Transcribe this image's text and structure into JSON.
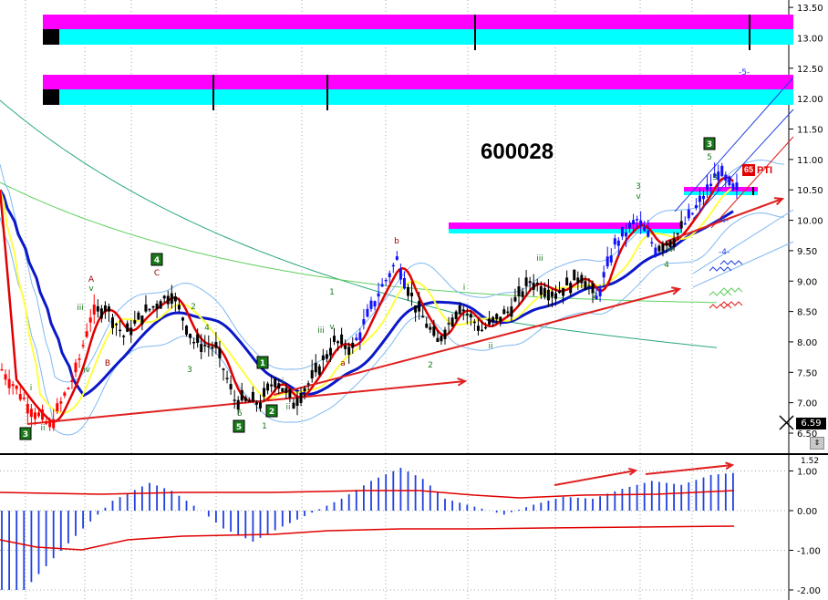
{
  "symbol": "600028",
  "pti": {
    "value": "65",
    "label": "PTI"
  },
  "last_price": "6.59",
  "osc_top_label": "1.52",
  "colors": {
    "bar": "#000000",
    "bar_up": "#1010ff",
    "bar_down": "#ff0000",
    "ma_fast": "#e00000",
    "ma_mid": "#ffff40",
    "ma_slow": "#0a18c8",
    "ma_long": "#2aa878",
    "ma_green": "#60d060",
    "ma_env": "#80b8f0",
    "magenta": "#ff00ff",
    "cyan": "#00ffff",
    "trend": "#e02020",
    "histogram": "#2040e0",
    "osc_line": "#e00000",
    "label_green": "#1a7a1a",
    "label_red": "#a00000"
  },
  "chart_data": [
    {
      "type": "candlestick",
      "title": "600028",
      "y_axis": {
        "ticks": [
          "13.50",
          "13.00",
          "12.50",
          "12.00",
          "11.50",
          "11.00",
          "10.50",
          "10.00",
          "9.50",
          "9.00",
          "8.50",
          "8.00",
          "7.50",
          "7.00",
          "6.50"
        ],
        "ylim": [
          6.3,
          13.6
        ]
      },
      "close_path": [
        {
          "bar": 0,
          "close": 7.55
        },
        {
          "bar": 8,
          "close": 6.9
        },
        {
          "bar": 13,
          "close": 6.6
        },
        {
          "bar": 20,
          "close": 7.5
        },
        {
          "bar": 24,
          "close": 8.4
        },
        {
          "bar": 28,
          "close": 8.6
        },
        {
          "bar": 33,
          "close": 8.1
        },
        {
          "bar": 39,
          "close": 8.5
        },
        {
          "bar": 46,
          "close": 8.8
        },
        {
          "bar": 52,
          "close": 8.0
        },
        {
          "bar": 58,
          "close": 7.9
        },
        {
          "bar": 63,
          "close": 7.05
        },
        {
          "bar": 70,
          "close": 7.0
        },
        {
          "bar": 74,
          "close": 7.4
        },
        {
          "bar": 79,
          "close": 7.0
        },
        {
          "bar": 84,
          "close": 7.4
        },
        {
          "bar": 90,
          "close": 8.0
        },
        {
          "bar": 95,
          "close": 7.9
        },
        {
          "bar": 102,
          "close": 8.8
        },
        {
          "bar": 107,
          "close": 9.35
        },
        {
          "bar": 112,
          "close": 8.6
        },
        {
          "bar": 118,
          "close": 8.0
        },
        {
          "bar": 124,
          "close": 8.6
        },
        {
          "bar": 130,
          "close": 8.2
        },
        {
          "bar": 137,
          "close": 8.5
        },
        {
          "bar": 143,
          "close": 9.0
        },
        {
          "bar": 150,
          "close": 8.8
        },
        {
          "bar": 157,
          "close": 9.1
        },
        {
          "bar": 161,
          "close": 8.7
        },
        {
          "bar": 166,
          "close": 9.6
        },
        {
          "bar": 172,
          "close": 10.0
        },
        {
          "bar": 177,
          "close": 9.55
        },
        {
          "bar": 182,
          "close": 9.7
        },
        {
          "bar": 188,
          "close": 10.2
        },
        {
          "bar": 194,
          "close": 10.8
        },
        {
          "bar": 198,
          "close": 10.5
        }
      ],
      "marker_bars": [
        {
          "label": "A",
          "bar": 24
        },
        {
          "label": "B",
          "bar": 28
        },
        {
          "label": "C",
          "bar": 42
        },
        {
          "label": "a",
          "bar": 93
        },
        {
          "label": "b",
          "bar": 107
        }
      ],
      "wave_labels": [
        "3",
        "ii",
        "i",
        "iii",
        "iv",
        "v",
        "A",
        "v",
        "B",
        "4",
        "C",
        "2",
        "3",
        "4",
        "5",
        "5",
        "1",
        "2",
        "ii",
        "i",
        "iii",
        "1",
        "v",
        "a",
        "b",
        "2",
        "i",
        "ii",
        "iii",
        "2",
        "3",
        "v",
        "4",
        "iv",
        "3",
        "5",
        "-4-",
        "-5-",
        "-4-"
      ],
      "boxed_labels": [
        "3",
        "4",
        "1",
        "5",
        "2",
        "3"
      ]
    },
    {
      "type": "bar",
      "title": "",
      "series": [
        {
          "name": "",
          "values_description": "oscillator histogram"
        }
      ],
      "y_axis": {
        "ticks": [
          "1.00",
          "0.00",
          "-1.00",
          "-2.00"
        ],
        "ylim": [
          -2.1,
          1.55
        ]
      },
      "hist_path": [
        {
          "bar": 0,
          "value": -2.0
        },
        {
          "bar": 6,
          "value": -2.0
        },
        {
          "bar": 14,
          "value": -1.2
        },
        {
          "bar": 22,
          "value": -0.45
        },
        {
          "bar": 30,
          "value": 0.25
        },
        {
          "bar": 40,
          "value": 0.7
        },
        {
          "bar": 46,
          "value": 0.5
        },
        {
          "bar": 54,
          "value": 0.0
        },
        {
          "bar": 60,
          "value": -0.45
        },
        {
          "bar": 68,
          "value": -0.78
        },
        {
          "bar": 76,
          "value": -0.4
        },
        {
          "bar": 84,
          "value": -0.05
        },
        {
          "bar": 92,
          "value": 0.3
        },
        {
          "bar": 100,
          "value": 0.75
        },
        {
          "bar": 108,
          "value": 1.08
        },
        {
          "bar": 114,
          "value": 0.8
        },
        {
          "bar": 120,
          "value": 0.3
        },
        {
          "bar": 128,
          "value": 0.1
        },
        {
          "bar": 136,
          "value": -0.1
        },
        {
          "bar": 144,
          "value": 0.15
        },
        {
          "bar": 152,
          "value": 0.35
        },
        {
          "bar": 160,
          "value": 0.3
        },
        {
          "bar": 168,
          "value": 0.55
        },
        {
          "bar": 176,
          "value": 0.75
        },
        {
          "bar": 184,
          "value": 0.65
        },
        {
          "bar": 192,
          "value": 0.9
        },
        {
          "bar": 198,
          "value": 0.95
        }
      ]
    }
  ]
}
